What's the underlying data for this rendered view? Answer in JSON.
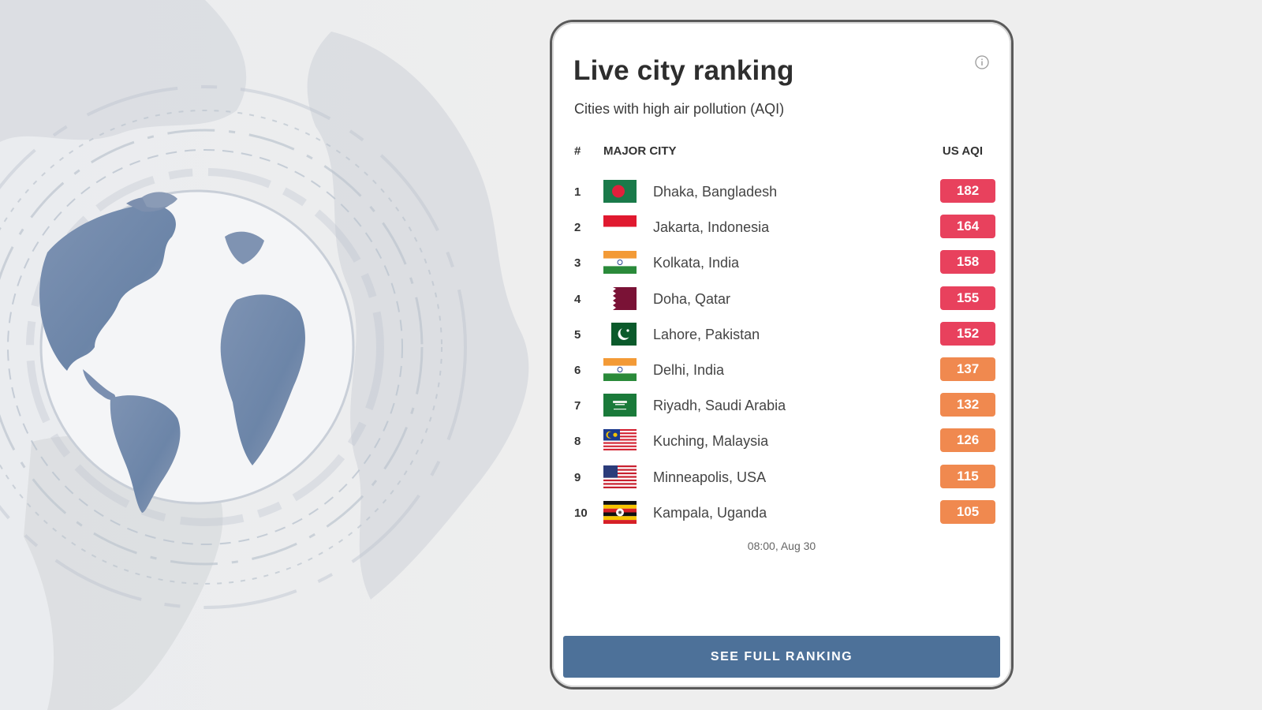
{
  "card": {
    "title": "Live city ranking",
    "subtitle": "Cities with high air pollution (AQI)",
    "info_icon": "info-icon",
    "columns": {
      "rank": "#",
      "city": "MAJOR CITY",
      "aqi": "US AQI"
    },
    "rows": [
      {
        "rank": "1",
        "city": "Dhaka, Bangladesh",
        "aqi": "182",
        "flag": "bangladesh-flag-icon",
        "color": "#e8415d"
      },
      {
        "rank": "2",
        "city": "Jakarta, Indonesia",
        "aqi": "164",
        "flag": "indonesia-flag-icon",
        "color": "#e8415d"
      },
      {
        "rank": "3",
        "city": "Kolkata, India",
        "aqi": "158",
        "flag": "india-flag-icon",
        "color": "#e8415d"
      },
      {
        "rank": "4",
        "city": "Doha, Qatar",
        "aqi": "155",
        "flag": "qatar-flag-icon",
        "color": "#e8415d"
      },
      {
        "rank": "5",
        "city": "Lahore, Pakistan",
        "aqi": "152",
        "flag": "pakistan-flag-icon",
        "color": "#e8415d"
      },
      {
        "rank": "6",
        "city": "Delhi, India",
        "aqi": "137",
        "flag": "india-flag-icon",
        "color": "#f0894f"
      },
      {
        "rank": "7",
        "city": "Riyadh, Saudi Arabia",
        "aqi": "132",
        "flag": "saudi-arabia-flag-icon",
        "color": "#f0894f"
      },
      {
        "rank": "8",
        "city": "Kuching, Malaysia",
        "aqi": "126",
        "flag": "malaysia-flag-icon",
        "color": "#f0894f"
      },
      {
        "rank": "9",
        "city": "Minneapolis, USA",
        "aqi": "115",
        "flag": "usa-flag-icon",
        "color": "#f0894f"
      },
      {
        "rank": "10",
        "city": "Kampala, Uganda",
        "aqi": "105",
        "flag": "uganda-flag-icon",
        "color": "#f0894f"
      }
    ],
    "timestamp": "08:00, Aug 30",
    "cta_label": "SEE FULL RANKING"
  }
}
